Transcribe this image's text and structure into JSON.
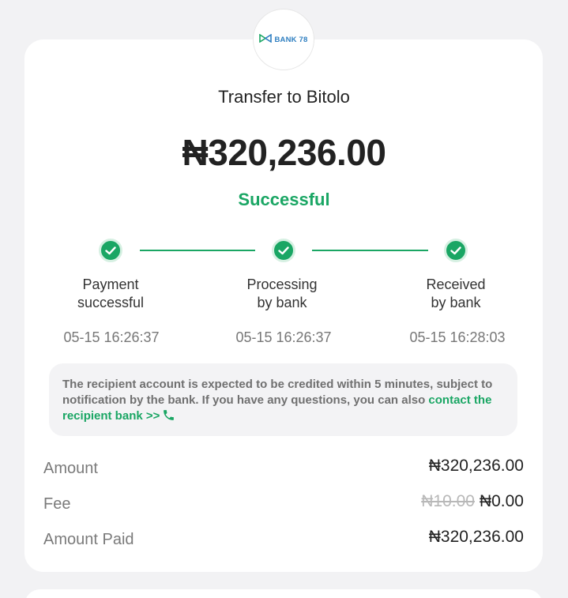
{
  "brand": {
    "logo_text": "BANK 78",
    "logo_icon": "bank-78-logo-icon",
    "accent_color": "#1aa664",
    "logo_color": "#2f7fc1"
  },
  "header": {
    "title": "Transfer to Bitolo",
    "amount": "₦320,236.00",
    "status": "Successful"
  },
  "steps": [
    {
      "label_line1": "Payment",
      "label_line2": "successful",
      "time": "05-15 16:26:37",
      "icon": "check-icon"
    },
    {
      "label_line1": "Processing",
      "label_line2": "by bank",
      "time": "05-15 16:26:37",
      "icon": "check-icon"
    },
    {
      "label_line1": "Received",
      "label_line2": "by bank",
      "time": "05-15 16:28:03",
      "icon": "check-icon"
    }
  ],
  "notice": {
    "text": "The recipient account is expected to be credited within 5 minutes, subject to notification by the bank. If you have any questions, you can also ",
    "link_text": "contact the recipient bank >>",
    "link_icon": "phone-icon"
  },
  "details": {
    "amount_label": "Amount",
    "amount_value": "₦320,236.00",
    "fee_label": "Fee",
    "fee_original": "₦10.00",
    "fee_value": "₦0.00",
    "paid_label": "Amount Paid",
    "paid_value": "₦320,236.00"
  }
}
